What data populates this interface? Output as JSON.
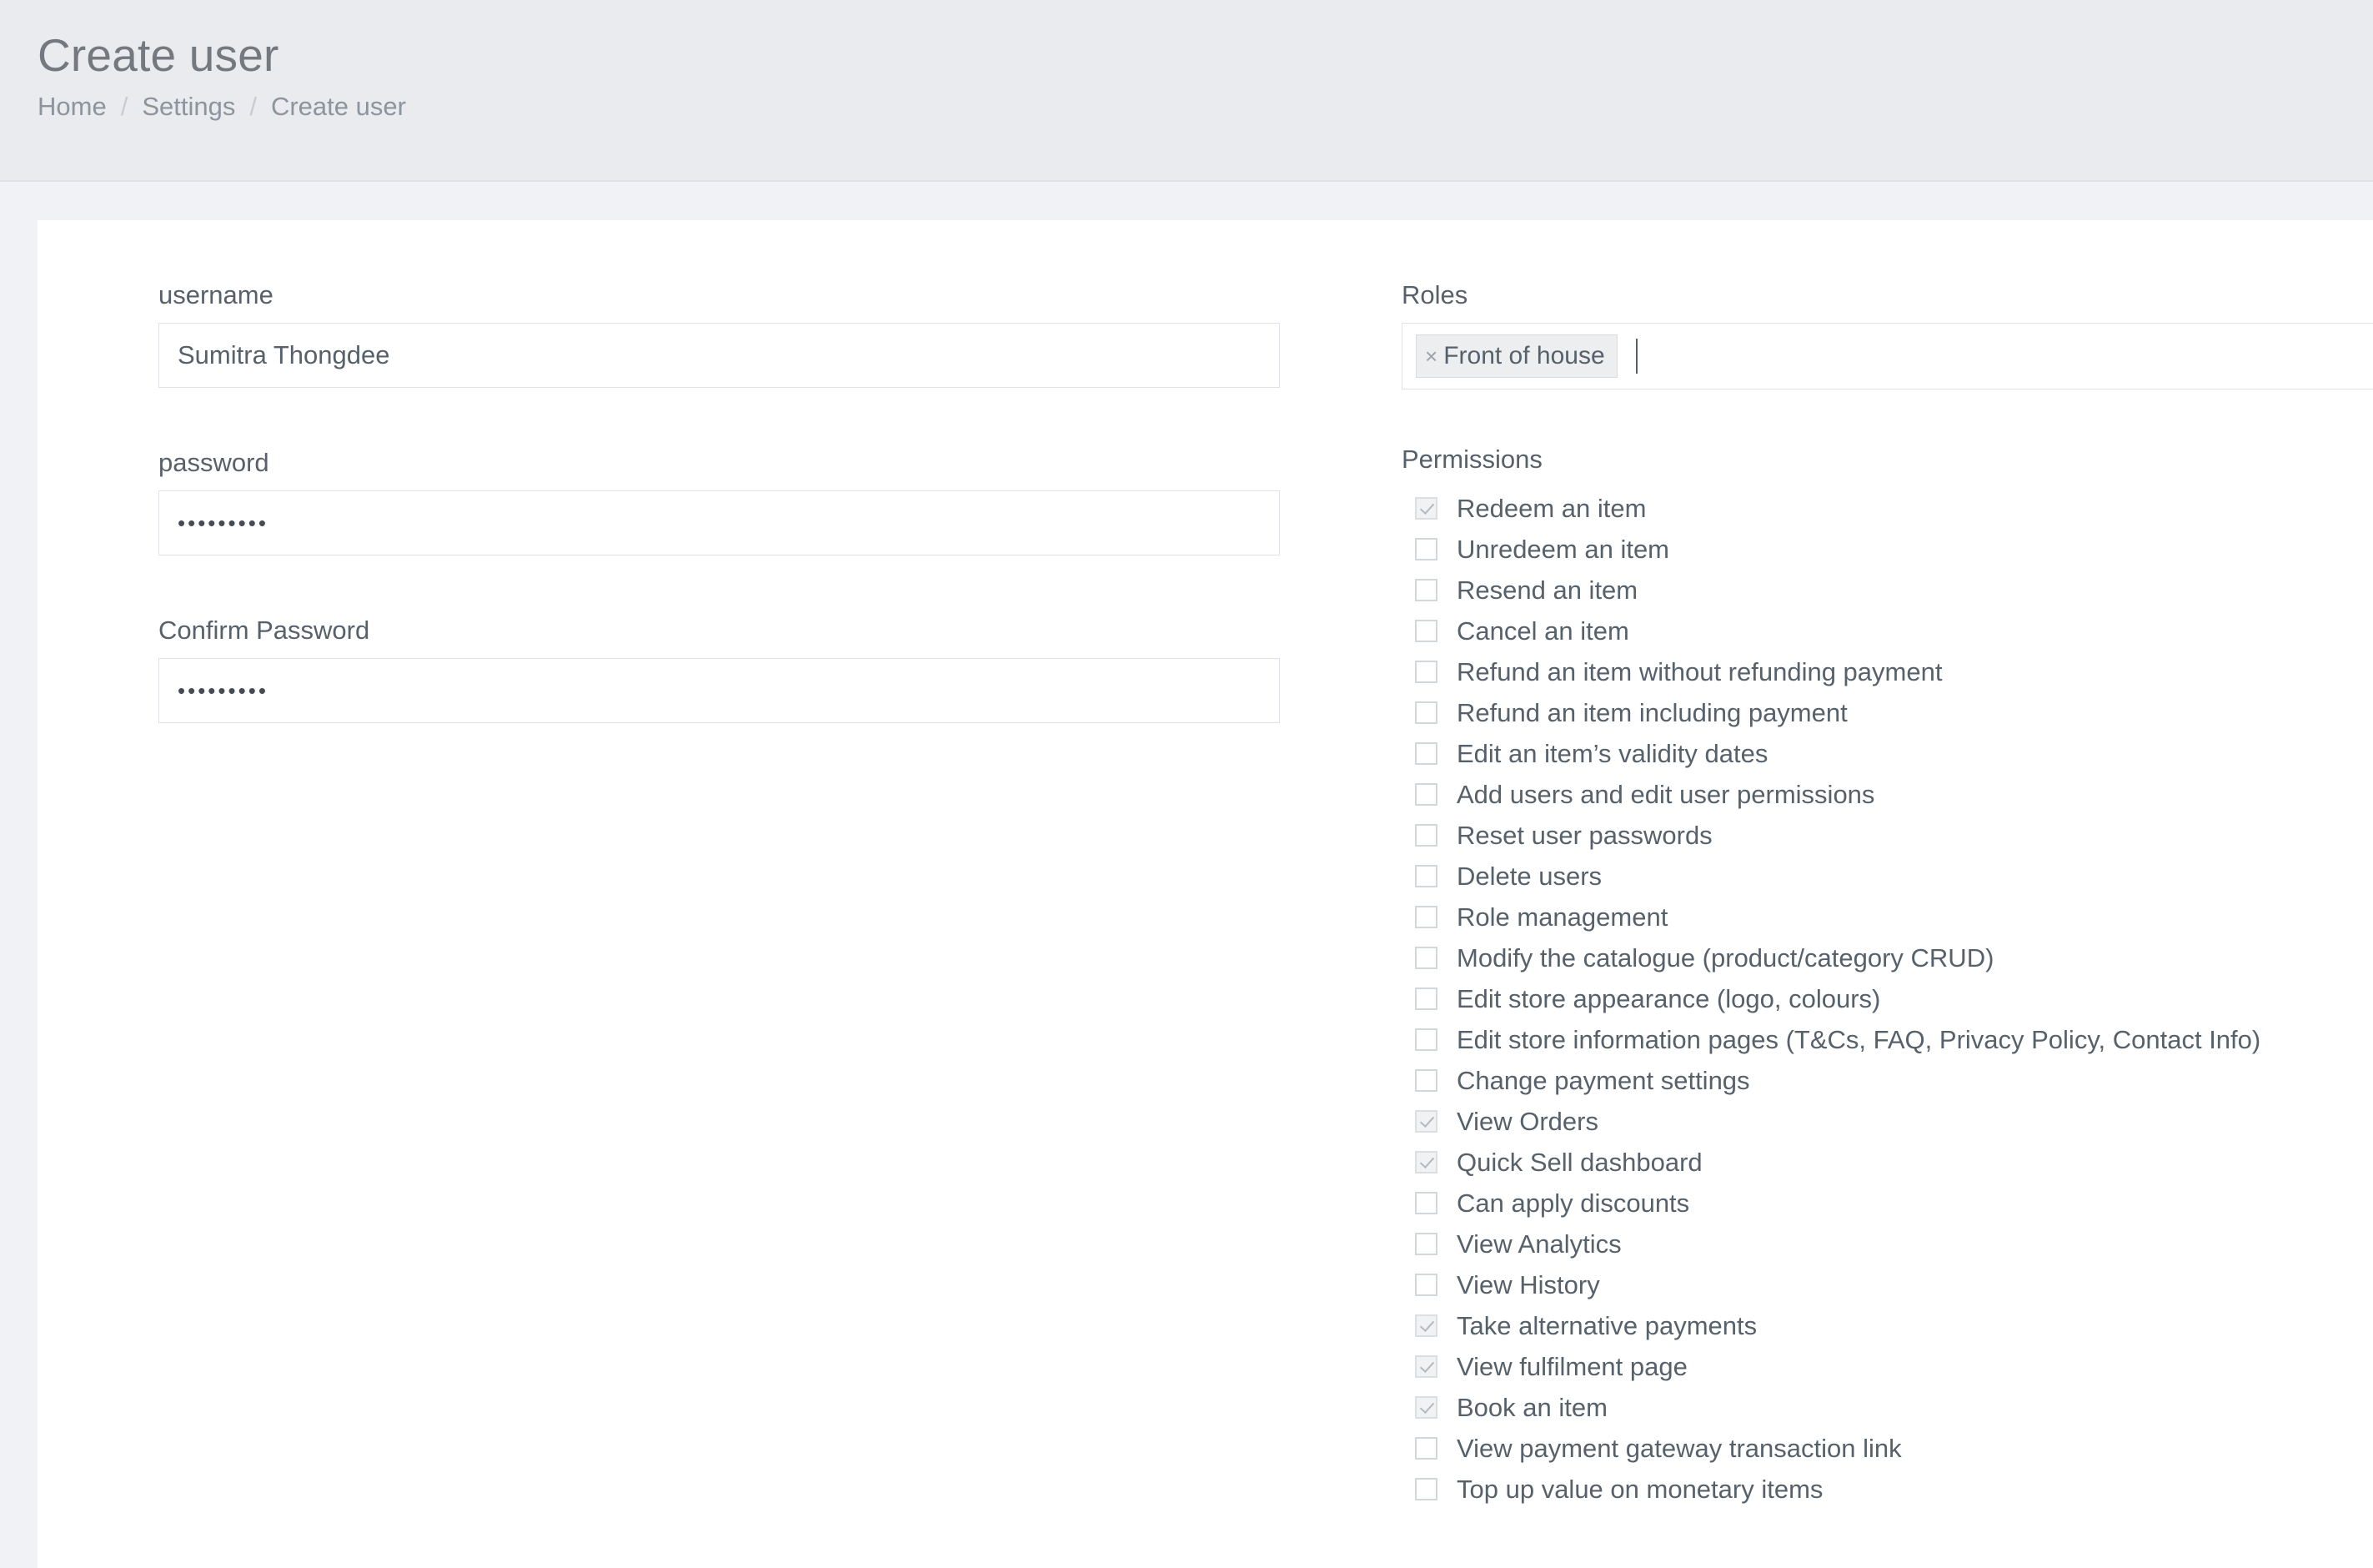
{
  "header": {
    "title": "Create user",
    "breadcrumb": [
      {
        "label": "Home",
        "link": true
      },
      {
        "label": "Settings",
        "link": true
      },
      {
        "label": "Create user",
        "link": false
      }
    ],
    "separator": "/"
  },
  "form": {
    "username": {
      "label": "username",
      "value": "Sumitra Thongdee",
      "placeholder": ""
    },
    "password": {
      "label": "password",
      "value": "•••••••••",
      "placeholder": ""
    },
    "confirm_password": {
      "label": "Confirm Password",
      "value": "•••••••••",
      "placeholder": ""
    }
  },
  "roles": {
    "label": "Roles",
    "tags": [
      {
        "label": "Front of house",
        "remove_glyph": "×"
      }
    ],
    "placeholder": ""
  },
  "permissions": {
    "label": "Permissions",
    "items": [
      {
        "label": "Redeem an item",
        "checked": true
      },
      {
        "label": "Unredeem an item",
        "checked": false
      },
      {
        "label": "Resend an item",
        "checked": false
      },
      {
        "label": "Cancel an item",
        "checked": false
      },
      {
        "label": "Refund an item without refunding payment",
        "checked": false
      },
      {
        "label": "Refund an item including payment",
        "checked": false
      },
      {
        "label": "Edit an item’s validity dates",
        "checked": false
      },
      {
        "label": "Add users and edit user permissions",
        "checked": false
      },
      {
        "label": "Reset user passwords",
        "checked": false
      },
      {
        "label": "Delete users",
        "checked": false
      },
      {
        "label": "Role management",
        "checked": false
      },
      {
        "label": "Modify the catalogue (product/category CRUD)",
        "checked": false
      },
      {
        "label": "Edit store appearance (logo, colours)",
        "checked": false
      },
      {
        "label": "Edit store information pages (T&Cs, FAQ, Privacy Policy, Contact Info)",
        "checked": false
      },
      {
        "label": "Change payment settings",
        "checked": false
      },
      {
        "label": "View Orders",
        "checked": true
      },
      {
        "label": "Quick Sell dashboard",
        "checked": true
      },
      {
        "label": "Can apply discounts",
        "checked": false
      },
      {
        "label": "View Analytics",
        "checked": false
      },
      {
        "label": "View History",
        "checked": false
      },
      {
        "label": "Take alternative payments",
        "checked": true
      },
      {
        "label": "View fulfilment page",
        "checked": true
      },
      {
        "label": "Book an item",
        "checked": true
      },
      {
        "label": "View payment gateway transaction link",
        "checked": false
      },
      {
        "label": "Top up value on monetary items",
        "checked": false
      }
    ]
  },
  "colors": {
    "header_band": "#e9ebee",
    "page_background": "#f1f2f6",
    "card_background": "#ffffff",
    "text": "#56616b",
    "muted_text": "#8c949c",
    "title_text": "#74797f",
    "border": "#dfe3e8",
    "tag_background": "#eceeef"
  }
}
